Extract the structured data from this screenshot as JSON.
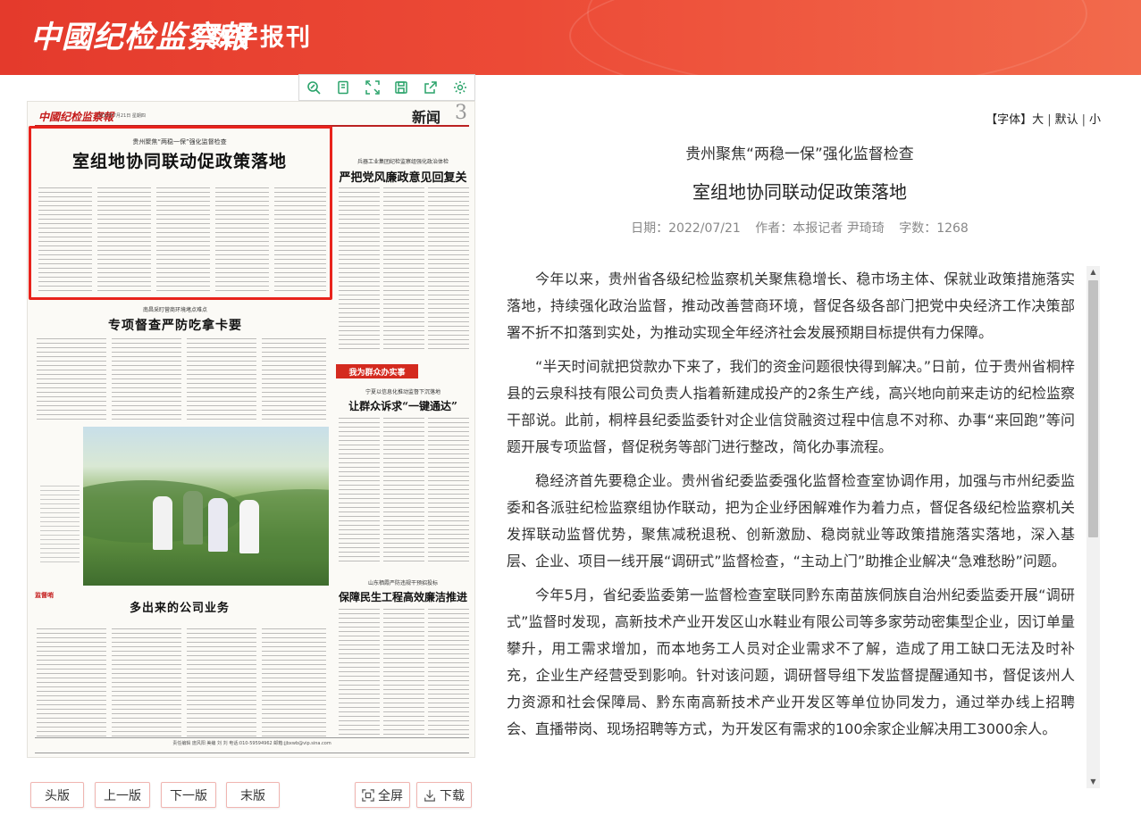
{
  "brand": {
    "logo_text": "中國纪检监察報",
    "section_text": "数字报刊"
  },
  "toolbar": {
    "icons": [
      "zoom-icon",
      "single-page-icon",
      "fit-screen-icon",
      "save-icon",
      "share-icon",
      "settings-icon"
    ]
  },
  "newspaper": {
    "masthead": "中國纪检监察報",
    "date_line": "2022年7月21日  星期四",
    "section": "新闻",
    "page_number": "3",
    "story1_kicker": "贵州聚焦“两稳一保”强化监督检查",
    "story1_headline": "室组地协同联动促政策落地",
    "story2_kicker": "兵器工业集团纪检监察组强化政治体检",
    "story2_headline": "严把党风廉政意见回复关",
    "story3_kicker": "南昌采盯营商环境堵点难点",
    "story3_headline": "专项督查严防吃拿卡要",
    "tag": "我为群众办实事",
    "story4_kicker": "宁夏以信息化推动监督下沉落地",
    "story4_headline": "让群众诉求“一键通达”",
    "story5_headline": "多出来的公司业务",
    "story6_kicker": "山东栖霞严防违规干预招投标",
    "story6_headline": "保障民生工程高效廉洁推进",
    "photo_credit": "监督哨",
    "footer": "责任编辑 庞风阳  美编 刘 刘 电话:010-59594962  邮箱:jjbxwb@vip.sina.com"
  },
  "nav": {
    "first": "头版",
    "prev": "上一版",
    "next": "下一版",
    "last": "末版",
    "fullscreen": "全屏",
    "download": "下载"
  },
  "fontsize": {
    "label": "【字体】",
    "large": "大",
    "default": "默认",
    "small": "小"
  },
  "article": {
    "kicker": "贵州聚焦“两稳一保”强化监督检查",
    "title": "室组地协同联动促政策落地",
    "date": "日期：2022/07/21",
    "author": "作者：本报记者 尹琦琦",
    "wordcount": "字数：1268",
    "paragraphs": [
      "今年以来，贵州省各级纪检监察机关聚焦稳增长、稳市场主体、保就业政策措施落实落地，持续强化政治监督，推动改善营商环境，督促各级各部门把党中央经济工作决策部署不折不扣落到实处，为推动实现全年经济社会发展预期目标提供有力保障。",
      "“半天时间就把贷款办下来了，我们的资金问题很快得到解决。”日前，位于贵州省桐梓县的云泉科技有限公司负责人指着新建成投产的2条生产线，高兴地向前来走访的纪检监察干部说。此前，桐梓县纪委监委针对企业信贷融资过程中信息不对称、办事“来回跑”等问题开展专项监督，督促税务等部门进行整改，简化办事流程。",
      "稳经济首先要稳企业。贵州省纪委监委强化监督检查室协调作用，加强与市州纪委监委和各派驻纪检监察组协作联动，把为企业纾困解难作为着力点，督促各级纪检监察机关发挥联动监督优势，聚焦减税退税、创新激励、稳岗就业等政策措施落实落地，深入基层、企业、项目一线开展“调研式”监督检查，“主动上门”助推企业解决“急难愁盼”问题。",
      "今年5月，省纪委监委第一监督检查室联同黔东南苗族侗族自治州纪委监委开展“调研式”监督时发现，高新技术产业开发区山水鞋业有限公司等多家劳动密集型企业，因订单量攀升，用工需求增加，而本地务工人员对企业需求不了解，造成了用工缺口无法及时补充，企业生产经营受到影响。针对该问题，调研督导组下发监督提醒通知书，督促该州人力资源和社会保障局、黔东南高新技术产业开发区等单位协同发力，通过举办线上招聘会、直播带岗、现场招聘等方式，为开发区有需求的100余家企业解决用工3000余人。"
    ]
  },
  "colors": {
    "brand_red": "#e43a2c",
    "highlight_red": "#e8231c",
    "tool_green": "#2aa36a"
  }
}
